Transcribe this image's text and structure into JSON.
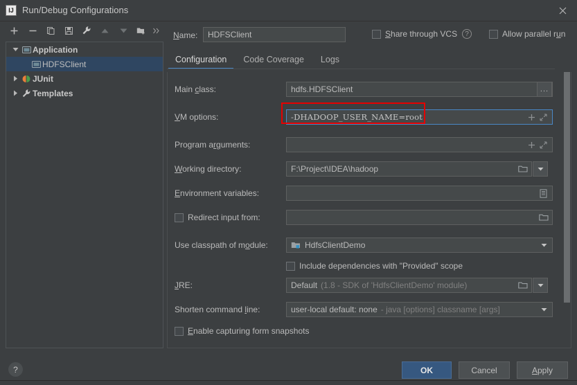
{
  "window": {
    "title": "Run/Debug Configurations",
    "app_icon_text": "IJ",
    "close_icon": "close-icon"
  },
  "toolbar": {
    "buttons": [
      {
        "name": "add-configuration",
        "icon": "plus-icon"
      },
      {
        "name": "remove-configuration",
        "icon": "minus-icon"
      },
      {
        "name": "copy-configuration",
        "icon": "copy-icon"
      },
      {
        "name": "save-configuration",
        "icon": "save-icon"
      },
      {
        "name": "edit-templates",
        "icon": "wrench-icon"
      },
      {
        "name": "move-up",
        "icon": "arrow-up-icon"
      },
      {
        "name": "move-down",
        "icon": "arrow-down-icon"
      },
      {
        "name": "new-folder",
        "icon": "folder-add-icon"
      },
      {
        "name": "more-actions",
        "icon": "chevron-double-right-icon"
      }
    ]
  },
  "tree": {
    "nodes": [
      {
        "label": "Application",
        "expanded": true,
        "icon": "application-icon",
        "bold": true,
        "selected": false,
        "indent": 0
      },
      {
        "label": "HDFSClient",
        "expanded": null,
        "icon": "application-icon",
        "bold": false,
        "selected": true,
        "indent": 1
      },
      {
        "label": "JUnit",
        "expanded": false,
        "icon": "junit-icon",
        "bold": true,
        "selected": false,
        "indent": 0
      },
      {
        "label": "Templates",
        "expanded": false,
        "icon": "wrench-icon",
        "bold": true,
        "selected": false,
        "indent": 0
      }
    ]
  },
  "header": {
    "name_label": "Name:",
    "name_mnemonic": "N",
    "name_value": "HDFSClient",
    "share_vcs_label": "Share through VCS",
    "share_vcs_mnemonic": "S",
    "share_vcs_checked": false,
    "help_icon": "question-icon",
    "allow_parallel_label": "Allow parallel run",
    "allow_parallel_mnemonic": "u",
    "allow_parallel_checked": false
  },
  "tabs": [
    {
      "label": "Configuration",
      "active": true
    },
    {
      "label": "Code Coverage",
      "active": false
    },
    {
      "label": "Logs",
      "active": false
    }
  ],
  "form": {
    "main_class": {
      "label": "Main class:",
      "mnemonic": "c",
      "value": "hdfs.HDFSClient",
      "browse_label": "..."
    },
    "vm_options": {
      "label": "VM options:",
      "mnemonic": "V",
      "value": "-DHADOOP_USER_NAME=root",
      "focused": true,
      "highlighted": true,
      "highlight_color": "#e60000",
      "focus_color": "#4a88c7",
      "macro_icon": "plus-icon",
      "expand_icon": "expand-icon"
    },
    "program_arguments": {
      "label": "Program arguments:",
      "mnemonic": "rg",
      "value": "",
      "macro_icon": "plus-icon",
      "expand_icon": "expand-icon"
    },
    "working_directory": {
      "label": "Working directory:",
      "mnemonic": "W",
      "value": "F:\\Project\\IDEA\\hadoop",
      "browse_icon": "folder-icon",
      "dropdown_icon": "chevron-down-icon"
    },
    "environment_variables": {
      "label": "Environment variables:",
      "mnemonic": "E",
      "value": "",
      "browse_icon": "list-icon"
    },
    "redirect_input": {
      "label": "Redirect input from:",
      "checked": false,
      "value": "",
      "browse_icon": "folder-icon"
    },
    "classpath_module": {
      "label": "Use classpath of module:",
      "mnemonic": "o",
      "value": "HdfsClientDemo",
      "module_icon": "module-icon",
      "dropdown_icon": "chevron-down-icon"
    },
    "include_provided": {
      "label": "Include dependencies with \"Provided\" scope",
      "checked": false
    },
    "jre": {
      "label": "JRE:",
      "mnemonic": "J",
      "value": "Default",
      "value_detail": "(1.8 - SDK of 'HdfsClientDemo' module)",
      "browse_icon": "folder-icon",
      "dropdown_icon": "chevron-down-icon"
    },
    "shorten_command_line": {
      "label": "Shorten command line:",
      "mnemonic": "l",
      "value": "user-local default: none",
      "value_detail": "- java [options] classname [args]",
      "dropdown_icon": "chevron-down-icon"
    },
    "form_snapshots": {
      "label": "Enable capturing form snapshots",
      "mnemonic": "E",
      "checked": false
    }
  },
  "footer": {
    "help_label": "?",
    "ok_label": "OK",
    "cancel_label": "Cancel",
    "apply_label": "Apply",
    "apply_mnemonic": "A"
  }
}
